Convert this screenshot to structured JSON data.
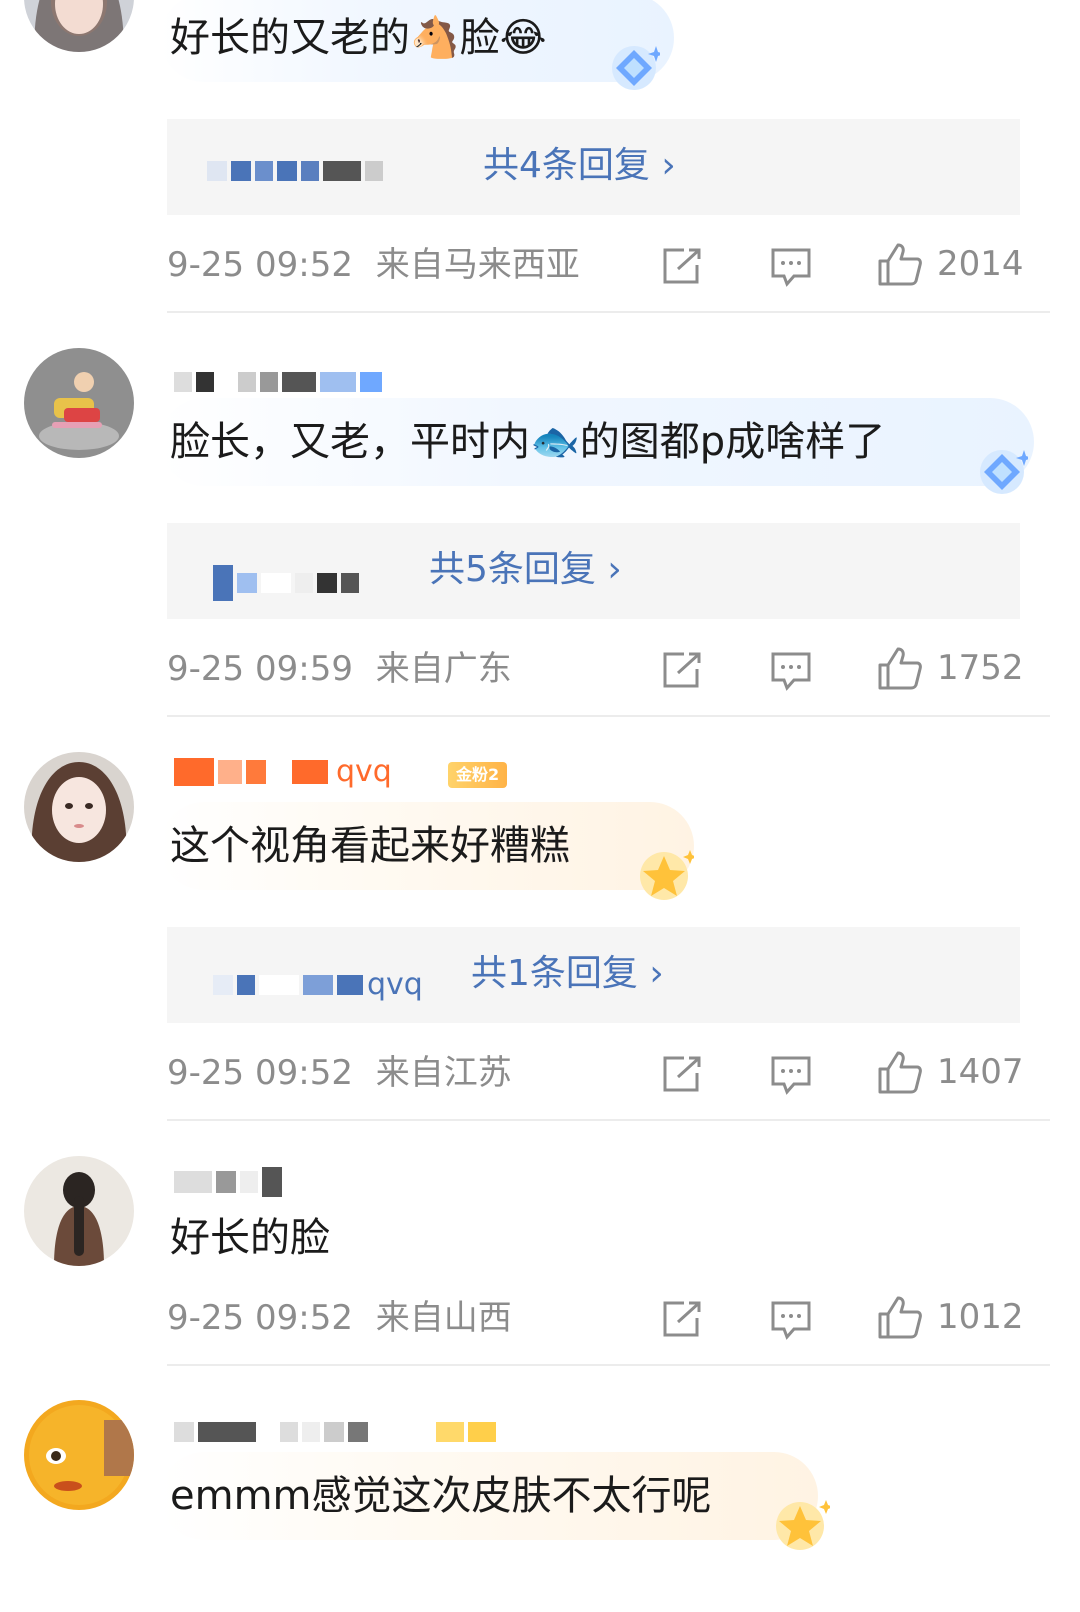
{
  "comments": [
    {
      "text": "好长的又老的🐴脸😂",
      "reply_link": "共4条回复 ›",
      "timestamp": "9-25 09:52",
      "location": "来自马来西亚",
      "likes": "2014",
      "bubble_style": "blue",
      "sticker": "diamond-badge-icon",
      "avatar": "woman-avatar-icon"
    },
    {
      "text": "脸长，又老，平时内🐟的图都p成啥样了",
      "reply_link": "共5条回复 ›",
      "timestamp": "9-25 09:59",
      "location": "来自广东",
      "likes": "1752",
      "bubble_style": "blue",
      "sticker": "diamond-badge-icon",
      "avatar": "scooter-avatar-icon"
    },
    {
      "text": "这个视角看起来好糟糕",
      "reply_link": "共1条回复 ›",
      "timestamp": "9-25 09:52",
      "location": "来自江苏",
      "likes": "1407",
      "bubble_style": "gold",
      "sticker": "star-badge-icon",
      "avatar": "girl-avatar-icon",
      "username_suffix": "qvq",
      "reply_name_suffix": "qvq",
      "fan_badge": "金粉2"
    },
    {
      "text": "好长的脸",
      "timestamp": "9-25 09:52",
      "location": "来自山西",
      "likes": "1012",
      "bubble_style": "plain",
      "avatar": "braid-avatar-icon"
    },
    {
      "text": "emmm感觉这次皮肤不太行呢",
      "bubble_style": "gold",
      "sticker": "star-badge-icon",
      "avatar": "orange-face-avatar-icon"
    }
  ],
  "colors": {
    "link_blue": "#4a74b8",
    "meta_gray": "#8c8c8c",
    "reply_bg": "#f5f5f5",
    "divider": "#ececec"
  }
}
